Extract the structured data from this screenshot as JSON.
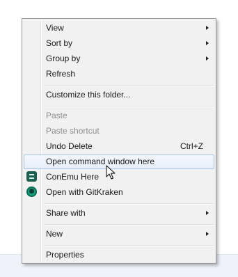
{
  "context_menu": {
    "items": [
      {
        "label": "View",
        "submenu": true
      },
      {
        "label": "Sort by",
        "submenu": true
      },
      {
        "label": "Group by",
        "submenu": true
      },
      {
        "label": "Refresh"
      },
      {
        "label": "Customize this folder..."
      },
      {
        "label": "Paste",
        "disabled": true
      },
      {
        "label": "Paste shortcut",
        "disabled": true
      },
      {
        "label": "Undo Delete",
        "shortcut": "Ctrl+Z"
      },
      {
        "label": "Open command window here",
        "highlighted": true
      },
      {
        "label": "ConEmu Here",
        "icon": "conemu-icon"
      },
      {
        "label": "Open with GitKraken",
        "icon": "gitkraken-icon"
      },
      {
        "label": "Share with",
        "submenu": true
      },
      {
        "label": "New",
        "submenu": true
      },
      {
        "label": "Properties"
      }
    ]
  },
  "colors": {
    "menu_background": "#f1f1f1",
    "highlight_border": "#a9c6e8",
    "disabled_text": "#8d8d8d",
    "conemu_icon": "#1f5f4f",
    "gitkraken_icon": "#19a37d"
  }
}
